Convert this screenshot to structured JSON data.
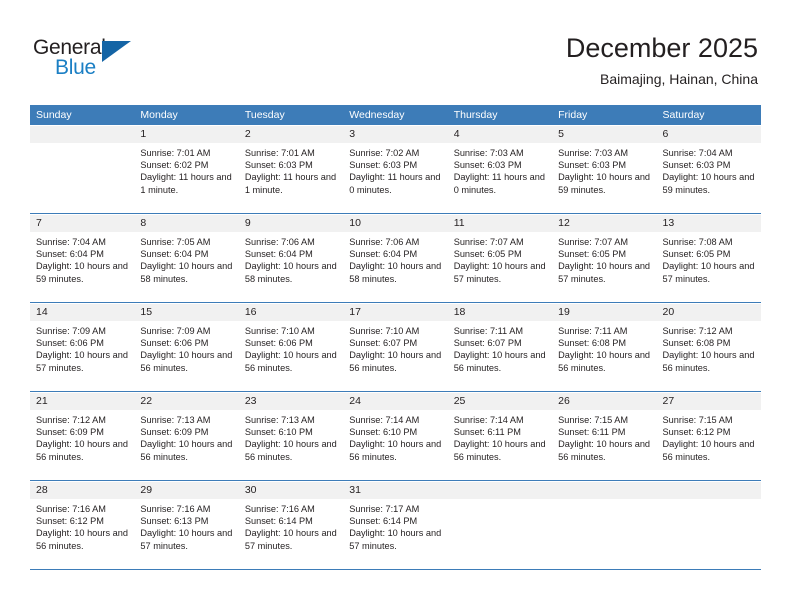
{
  "brand": {
    "name_part1": "General",
    "name_part2": "Blue",
    "accent_color": "#1b7fc4",
    "triangle_color": "#1464a5"
  },
  "header": {
    "title": "December 2025",
    "location": "Baimajing, Hainan, China",
    "header_bg": "#3d7cb8",
    "day_band_bg": "#f1f1f1"
  },
  "weekdays": [
    "Sunday",
    "Monday",
    "Tuesday",
    "Wednesday",
    "Thursday",
    "Friday",
    "Saturday"
  ],
  "weeks": [
    [
      {
        "day": "",
        "sunrise": "",
        "sunset": "",
        "daylight": "",
        "empty": true
      },
      {
        "day": "1",
        "sunrise": "Sunrise: 7:01 AM",
        "sunset": "Sunset: 6:02 PM",
        "daylight": "Daylight: 11 hours and 1 minute."
      },
      {
        "day": "2",
        "sunrise": "Sunrise: 7:01 AM",
        "sunset": "Sunset: 6:03 PM",
        "daylight": "Daylight: 11 hours and 1 minute."
      },
      {
        "day": "3",
        "sunrise": "Sunrise: 7:02 AM",
        "sunset": "Sunset: 6:03 PM",
        "daylight": "Daylight: 11 hours and 0 minutes."
      },
      {
        "day": "4",
        "sunrise": "Sunrise: 7:03 AM",
        "sunset": "Sunset: 6:03 PM",
        "daylight": "Daylight: 11 hours and 0 minutes."
      },
      {
        "day": "5",
        "sunrise": "Sunrise: 7:03 AM",
        "sunset": "Sunset: 6:03 PM",
        "daylight": "Daylight: 10 hours and 59 minutes."
      },
      {
        "day": "6",
        "sunrise": "Sunrise: 7:04 AM",
        "sunset": "Sunset: 6:03 PM",
        "daylight": "Daylight: 10 hours and 59 minutes."
      }
    ],
    [
      {
        "day": "7",
        "sunrise": "Sunrise: 7:04 AM",
        "sunset": "Sunset: 6:04 PM",
        "daylight": "Daylight: 10 hours and 59 minutes."
      },
      {
        "day": "8",
        "sunrise": "Sunrise: 7:05 AM",
        "sunset": "Sunset: 6:04 PM",
        "daylight": "Daylight: 10 hours and 58 minutes."
      },
      {
        "day": "9",
        "sunrise": "Sunrise: 7:06 AM",
        "sunset": "Sunset: 6:04 PM",
        "daylight": "Daylight: 10 hours and 58 minutes."
      },
      {
        "day": "10",
        "sunrise": "Sunrise: 7:06 AM",
        "sunset": "Sunset: 6:04 PM",
        "daylight": "Daylight: 10 hours and 58 minutes."
      },
      {
        "day": "11",
        "sunrise": "Sunrise: 7:07 AM",
        "sunset": "Sunset: 6:05 PM",
        "daylight": "Daylight: 10 hours and 57 minutes."
      },
      {
        "day": "12",
        "sunrise": "Sunrise: 7:07 AM",
        "sunset": "Sunset: 6:05 PM",
        "daylight": "Daylight: 10 hours and 57 minutes."
      },
      {
        "day": "13",
        "sunrise": "Sunrise: 7:08 AM",
        "sunset": "Sunset: 6:05 PM",
        "daylight": "Daylight: 10 hours and 57 minutes."
      }
    ],
    [
      {
        "day": "14",
        "sunrise": "Sunrise: 7:09 AM",
        "sunset": "Sunset: 6:06 PM",
        "daylight": "Daylight: 10 hours and 57 minutes."
      },
      {
        "day": "15",
        "sunrise": "Sunrise: 7:09 AM",
        "sunset": "Sunset: 6:06 PM",
        "daylight": "Daylight: 10 hours and 56 minutes."
      },
      {
        "day": "16",
        "sunrise": "Sunrise: 7:10 AM",
        "sunset": "Sunset: 6:06 PM",
        "daylight": "Daylight: 10 hours and 56 minutes."
      },
      {
        "day": "17",
        "sunrise": "Sunrise: 7:10 AM",
        "sunset": "Sunset: 6:07 PM",
        "daylight": "Daylight: 10 hours and 56 minutes."
      },
      {
        "day": "18",
        "sunrise": "Sunrise: 7:11 AM",
        "sunset": "Sunset: 6:07 PM",
        "daylight": "Daylight: 10 hours and 56 minutes."
      },
      {
        "day": "19",
        "sunrise": "Sunrise: 7:11 AM",
        "sunset": "Sunset: 6:08 PM",
        "daylight": "Daylight: 10 hours and 56 minutes."
      },
      {
        "day": "20",
        "sunrise": "Sunrise: 7:12 AM",
        "sunset": "Sunset: 6:08 PM",
        "daylight": "Daylight: 10 hours and 56 minutes."
      }
    ],
    [
      {
        "day": "21",
        "sunrise": "Sunrise: 7:12 AM",
        "sunset": "Sunset: 6:09 PM",
        "daylight": "Daylight: 10 hours and 56 minutes."
      },
      {
        "day": "22",
        "sunrise": "Sunrise: 7:13 AM",
        "sunset": "Sunset: 6:09 PM",
        "daylight": "Daylight: 10 hours and 56 minutes."
      },
      {
        "day": "23",
        "sunrise": "Sunrise: 7:13 AM",
        "sunset": "Sunset: 6:10 PM",
        "daylight": "Daylight: 10 hours and 56 minutes."
      },
      {
        "day": "24",
        "sunrise": "Sunrise: 7:14 AM",
        "sunset": "Sunset: 6:10 PM",
        "daylight": "Daylight: 10 hours and 56 minutes."
      },
      {
        "day": "25",
        "sunrise": "Sunrise: 7:14 AM",
        "sunset": "Sunset: 6:11 PM",
        "daylight": "Daylight: 10 hours and 56 minutes."
      },
      {
        "day": "26",
        "sunrise": "Sunrise: 7:15 AM",
        "sunset": "Sunset: 6:11 PM",
        "daylight": "Daylight: 10 hours and 56 minutes."
      },
      {
        "day": "27",
        "sunrise": "Sunrise: 7:15 AM",
        "sunset": "Sunset: 6:12 PM",
        "daylight": "Daylight: 10 hours and 56 minutes."
      }
    ],
    [
      {
        "day": "28",
        "sunrise": "Sunrise: 7:16 AM",
        "sunset": "Sunset: 6:12 PM",
        "daylight": "Daylight: 10 hours and 56 minutes."
      },
      {
        "day": "29",
        "sunrise": "Sunrise: 7:16 AM",
        "sunset": "Sunset: 6:13 PM",
        "daylight": "Daylight: 10 hours and 57 minutes."
      },
      {
        "day": "30",
        "sunrise": "Sunrise: 7:16 AM",
        "sunset": "Sunset: 6:14 PM",
        "daylight": "Daylight: 10 hours and 57 minutes."
      },
      {
        "day": "31",
        "sunrise": "Sunrise: 7:17 AM",
        "sunset": "Sunset: 6:14 PM",
        "daylight": "Daylight: 10 hours and 57 minutes."
      },
      {
        "day": "",
        "sunrise": "",
        "sunset": "",
        "daylight": "",
        "empty": true
      },
      {
        "day": "",
        "sunrise": "",
        "sunset": "",
        "daylight": "",
        "empty": true
      },
      {
        "day": "",
        "sunrise": "",
        "sunset": "",
        "daylight": "",
        "empty": true
      }
    ]
  ]
}
